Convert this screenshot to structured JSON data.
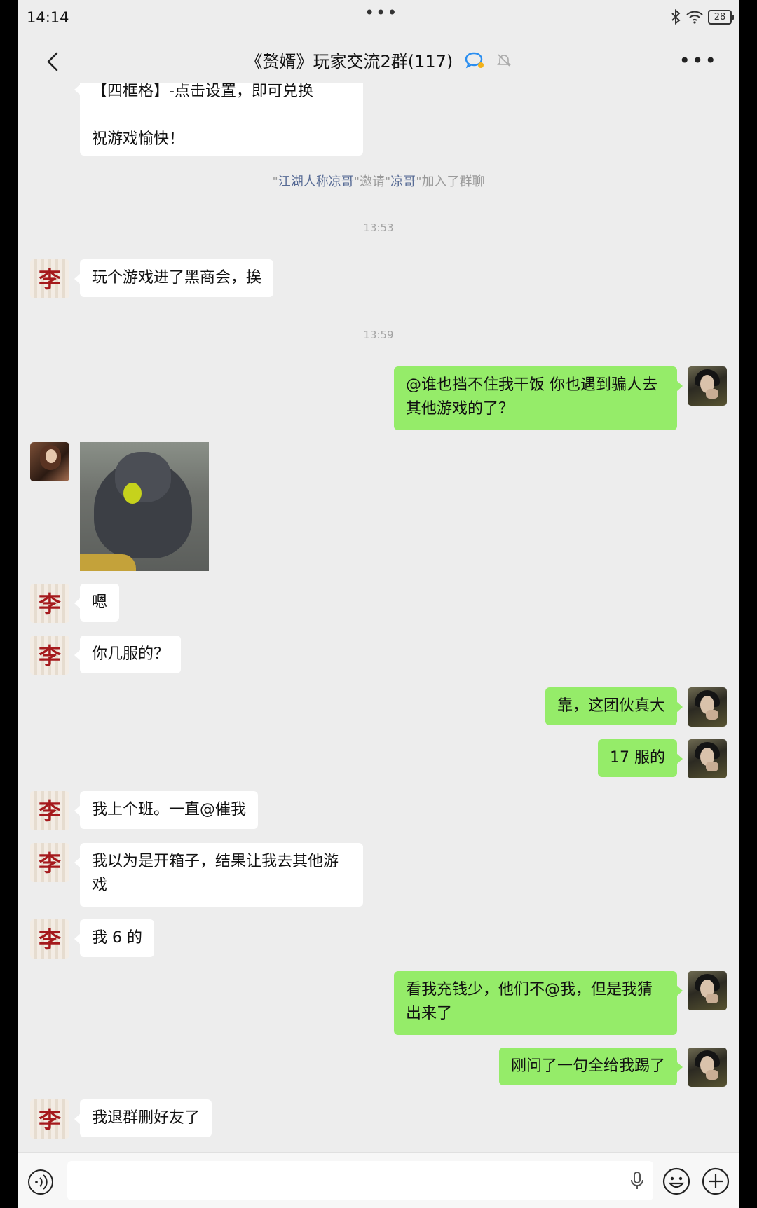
{
  "status_bar": {
    "time": "14:14",
    "battery": "28"
  },
  "header": {
    "title": "《赘婿》玩家交流2群(117)"
  },
  "messages": {
    "partial_intro": {
      "line1": "【四框格】-点击设置，即可兑换",
      "line2": "祝游戏愉快！"
    },
    "system_invite": {
      "q1": "\"",
      "inviter": "江湖人称凉哥",
      "q2": "\"邀请\"",
      "invitee": "凉哥",
      "q3": "\"加入了群聊"
    },
    "time1": "13:53",
    "m1": "玩个游戏进了黑商会，挨",
    "time2": "13:59",
    "m2": "@谁也挡不住我干饭  你也遇到骗人去其他游戏的了？",
    "m3": "嗯",
    "m4": "你几服的？",
    "m5": "靠，这团伙真大",
    "m6": "17 服的",
    "m7": "我上个班。一直@催我",
    "m8": "我以为是开箱子，结果让我去其他游戏",
    "m9": "我 6 的",
    "m10": "看我充钱少，他们不@我，但是我猜出来了",
    "m11": "刚问了一句全给我踢了",
    "m12": "我退群删好友了"
  },
  "avatars": {
    "li_char": "李"
  },
  "icons": {
    "back": "chevron-left-icon",
    "group_status": "chat-bubble-icon",
    "mute": "bell-off-icon",
    "more": "more-icon",
    "voice": "voice-mode-icon",
    "mic": "microphone-icon",
    "emoji": "emoji-icon",
    "add": "plus-icon"
  },
  "colors": {
    "out_bubble": "#95ec69",
    "in_bubble": "#ffffff",
    "background": "#ededed",
    "link": "#576b95"
  }
}
